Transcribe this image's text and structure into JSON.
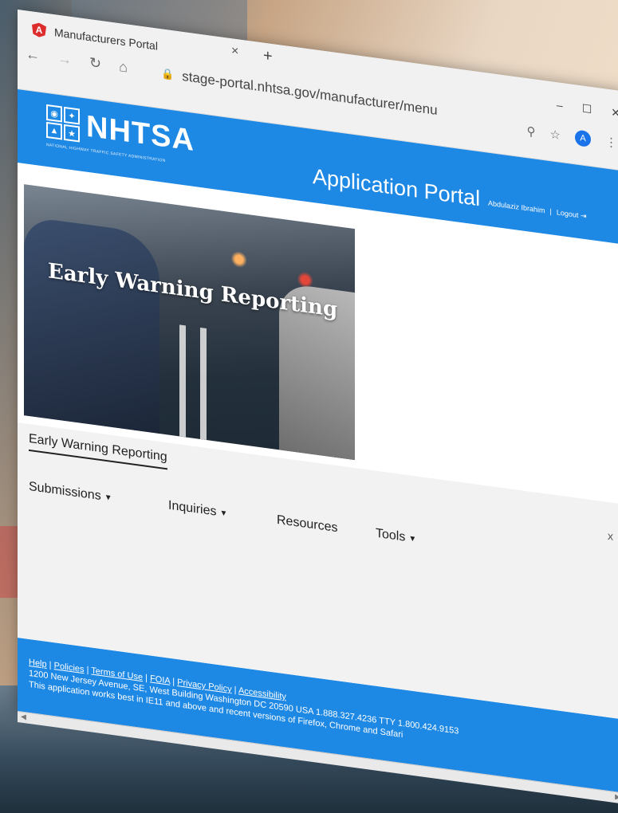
{
  "browser": {
    "tab_title": "Manufacturers Portal",
    "tab_close": "×",
    "new_tab": "+",
    "url": "stage-portal.nhtsa.gov/manufacturer/menu",
    "avatar_letter": "A"
  },
  "header": {
    "logo_text": "NHTSA",
    "logo_subtitle": "NATIONAL HIGHWAY TRAFFIC SAFETY ADMINISTRATION",
    "app_title": "Application Portal",
    "user_name": "Abdulaziz Ibrahim",
    "separator": "|",
    "logout_label": "Logout"
  },
  "hero": {
    "title": "Early Warning Reporting"
  },
  "section": {
    "title": "Early Warning Reporting",
    "close_label": "x"
  },
  "menu": [
    {
      "label": "Submissions",
      "has_dropdown": true
    },
    {
      "label": "Inquiries",
      "has_dropdown": true
    },
    {
      "label": "Resources",
      "has_dropdown": false
    },
    {
      "label": "Tools",
      "has_dropdown": true
    }
  ],
  "footer": {
    "links": [
      "Help",
      "Policies",
      "Terms of Use",
      "FOIA",
      "Privacy Policy",
      "Accessibility"
    ],
    "address": "1200 New Jersey Avenue, SE, West Building Washington DC 20590 USA 1.888.327.4236 TTY 1.800.424.9153",
    "browser_note": "This application works best in IE11 and above and recent versions of Firefox, Chrome and Safari"
  },
  "colors": {
    "brand_blue": "#1e88e5",
    "angular_red": "#dd2c2c"
  }
}
